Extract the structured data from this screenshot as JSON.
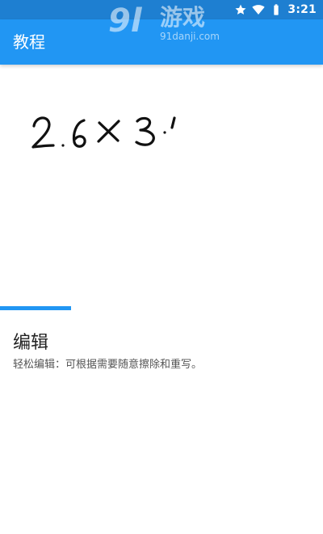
{
  "status_bar": {
    "time": "3:21",
    "icons": [
      "star-icon",
      "wifi-icon",
      "battery-icon"
    ]
  },
  "app_bar": {
    "title": "教程"
  },
  "watermark": {
    "logo": "9l",
    "text": "游戏",
    "url": "91danji.com"
  },
  "tutorial": {
    "demo_handwriting": "2.6×3.1",
    "progress_fraction": 0.22,
    "step_title": "编辑",
    "step_description": "轻松编辑：可根据需要随意擦除和重写。"
  },
  "colors": {
    "status_bar": "#1e7fd1",
    "app_bar": "#2196f3",
    "accent": "#2196f3"
  }
}
